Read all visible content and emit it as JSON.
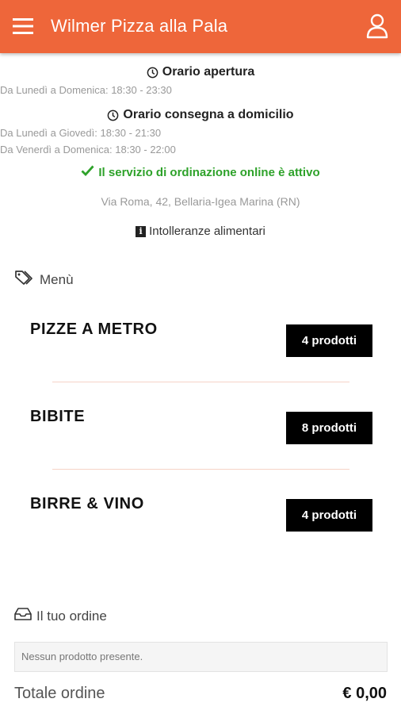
{
  "header": {
    "title": "Wilmer Pizza alla Pala",
    "accent_color": "#ee663a",
    "menu_icon": "hamburger-menu-icon",
    "user_icon": "user-icon"
  },
  "info": {
    "opening_title": "Orario apertura",
    "opening_hours": "Da Lunedì a Domenica: 18:30 - 23:30",
    "delivery_title": "Orario consegna a domicilio",
    "delivery_hours_1": "Da Lunedì a Giovedì: 18:30 - 21:30",
    "delivery_hours_2": "Da Venerdì a Domenica: 18:30 - 22:00",
    "online_status": "Il servizio di ordinazione online è attivo",
    "online_status_color": "#2ea22a",
    "address": "Via Roma, 42, Bellaria-Igea Marina (RN)",
    "allergy_link": "Intolleranze alimentari"
  },
  "menu": {
    "heading": "Menù",
    "categories": [
      {
        "name": "PIZZE A METRO",
        "count_label": "4 prodotti"
      },
      {
        "name": "BIBITE",
        "count_label": "8 prodotti"
      },
      {
        "name": "BIRRE & VINO",
        "count_label": "4 prodotti"
      }
    ]
  },
  "order": {
    "heading": "Il tuo ordine",
    "empty_message": "Nessun prodotto presente.",
    "total_label": "Totale ordine",
    "total_value": "€ 0,00"
  }
}
